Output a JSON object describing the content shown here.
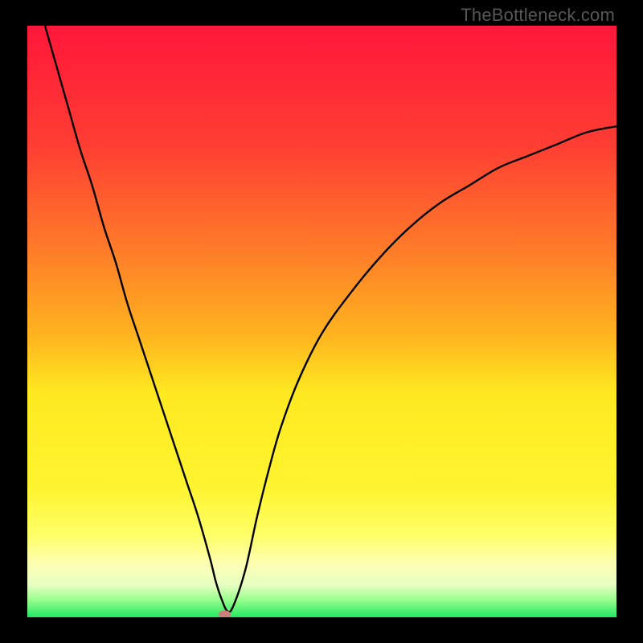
{
  "watermark": "TheBottleneck.com",
  "colors": {
    "red": "#ff173a",
    "orange": "#ff9a1b",
    "yellow": "#ffe921",
    "pale": "#fdffb3",
    "green": "#22e763",
    "black": "#000000",
    "curve": "#000000",
    "marker": "#cd7e7b",
    "watermark": "#575757"
  },
  "chart_data": {
    "type": "line",
    "title": "",
    "xlabel": "",
    "ylabel": "",
    "xlim": [
      0,
      100
    ],
    "ylim": [
      0,
      100
    ],
    "series": [
      {
        "name": "bottleneck-curve",
        "x": [
          3,
          5,
          7,
          9,
          11,
          13,
          15,
          17,
          19,
          21,
          23,
          25,
          27,
          29,
          31,
          32,
          33,
          34,
          35,
          37,
          39,
          41,
          43,
          46,
          50,
          55,
          60,
          65,
          70,
          75,
          80,
          85,
          90,
          95,
          100
        ],
        "y": [
          100,
          93,
          86,
          79,
          73,
          66,
          60,
          53,
          47,
          41,
          35,
          29,
          23,
          17,
          10,
          6,
          3,
          1,
          2,
          8,
          17,
          25,
          32,
          40,
          48,
          55,
          61,
          66,
          70,
          73,
          76,
          78,
          80,
          82,
          83
        ]
      }
    ],
    "marker": {
      "x": 33.5,
      "y": 0.5
    },
    "gradient_stops": [
      {
        "pct": 0,
        "color": "#ff173a"
      },
      {
        "pct": 38,
        "color": "#ff7c29"
      },
      {
        "pct": 62,
        "color": "#ffe921"
      },
      {
        "pct": 84,
        "color": "#ffff66"
      },
      {
        "pct": 92,
        "color": "#fdffb3"
      },
      {
        "pct": 97,
        "color": "#9bff8e"
      },
      {
        "pct": 100,
        "color": "#22e763"
      }
    ]
  }
}
